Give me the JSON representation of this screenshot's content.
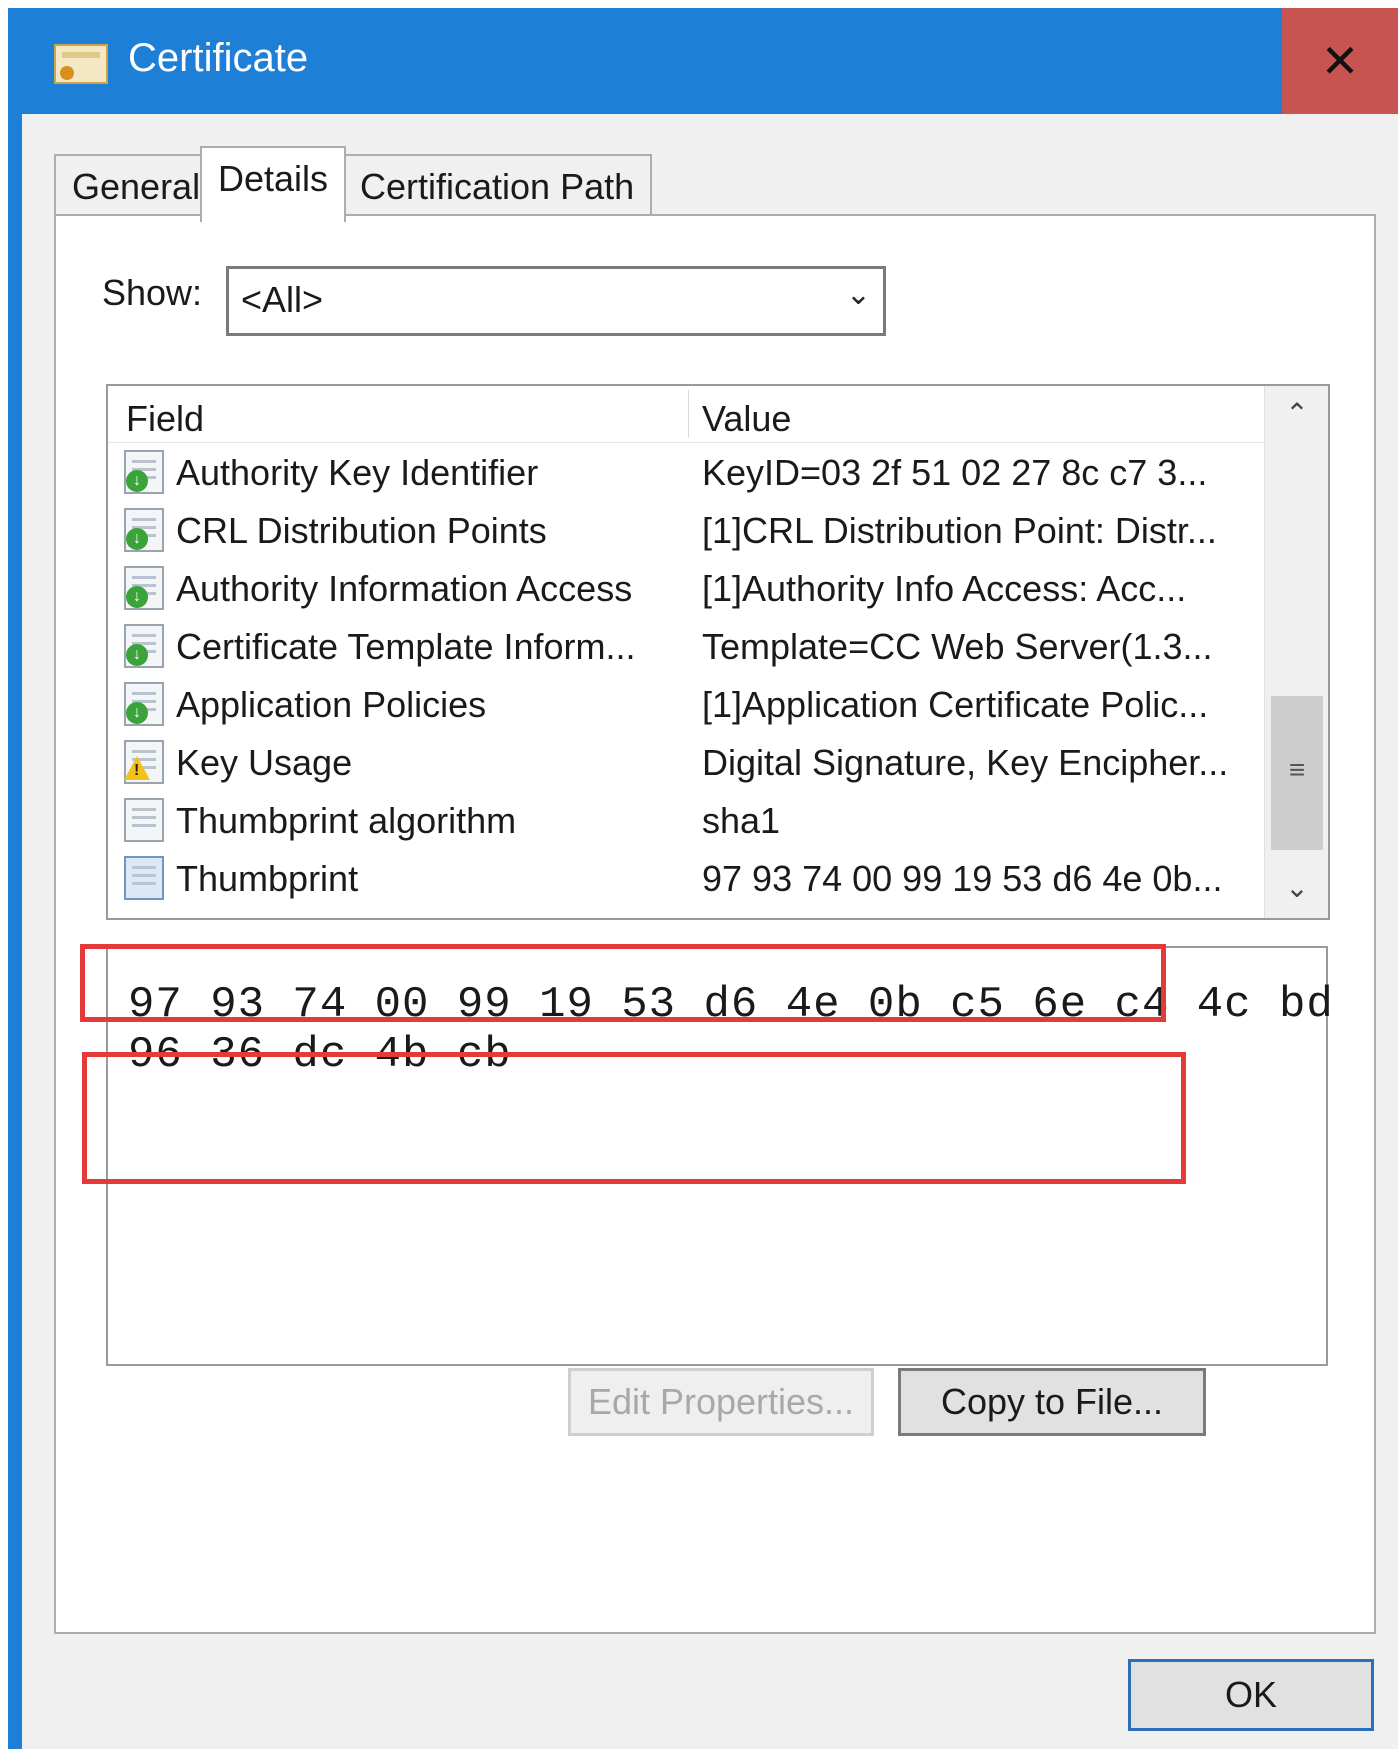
{
  "window": {
    "title": "Certificate",
    "close_glyph": "✕"
  },
  "tabs": [
    {
      "label": "General",
      "active": false
    },
    {
      "label": "Details",
      "active": true
    },
    {
      "label": "Certification Path",
      "active": false
    }
  ],
  "show": {
    "label": "Show:",
    "selected": "<All>"
  },
  "list": {
    "columns": [
      "Field",
      "Value"
    ],
    "rows": [
      {
        "field": "Authority Key Identifier",
        "value": "KeyID=03 2f 51 02 27 8c c7 3...",
        "icon": "extension-ok-icon"
      },
      {
        "field": "CRL Distribution Points",
        "value": "[1]CRL Distribution Point: Distr...",
        "icon": "extension-ok-icon"
      },
      {
        "field": "Authority Information Access",
        "value": "[1]Authority Info Access: Acc...",
        "icon": "extension-ok-icon"
      },
      {
        "field": "Certificate Template Inform...",
        "value": "Template=CC Web Server(1.3...",
        "icon": "extension-ok-icon"
      },
      {
        "field": "Application Policies",
        "value": "[1]Application Certificate Polic...",
        "icon": "extension-ok-icon"
      },
      {
        "field": "Key Usage",
        "value": "Digital Signature, Key Encipher...",
        "icon": "critical-extension-warning-icon"
      },
      {
        "field": "Thumbprint algorithm",
        "value": "sha1",
        "icon": "property-icon"
      },
      {
        "field": "Thumbprint",
        "value": "97 93 74 00 99 19 53 d6 4e 0b...",
        "icon": "property-icon",
        "selected": true
      }
    ]
  },
  "detail": {
    "line1": "97 93 74 00 99 19 53 d6 4e 0b c5 6e c4 4c bd",
    "line2": "96 36 dc 4b cb"
  },
  "buttons": {
    "edit_properties": "Edit Properties...",
    "copy_to_file": "Copy to File...",
    "ok": "OK"
  },
  "colors": {
    "titlebar": "#1e7fd6",
    "close_button": "#c75450",
    "highlight": "#e43a3a"
  }
}
